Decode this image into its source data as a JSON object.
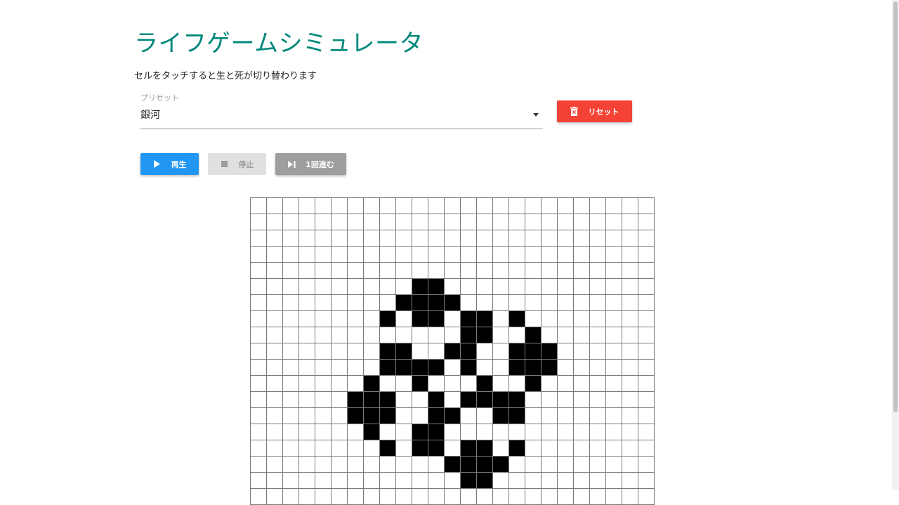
{
  "page": {
    "title": "ライフゲームシミュレータ",
    "description": "セルをタッチすると生と死が切り替わります"
  },
  "preset": {
    "label": "プリセット",
    "value": "銀河"
  },
  "buttons": {
    "reset": {
      "label": "リセット",
      "icon": "trash-icon"
    },
    "play": {
      "label": "再生",
      "icon": "play-icon"
    },
    "stop": {
      "label": "停止",
      "icon": "stop-icon"
    },
    "step": {
      "label": "1回進む",
      "icon": "skip-next-icon"
    }
  },
  "colors": {
    "accent": "#00897b",
    "reset": "#f44336",
    "play": "#2196f3",
    "stop_disabled": "#e0e0e0",
    "step": "#9e9e9e"
  },
  "grid": {
    "columns": 25,
    "visible_rows": 19,
    "alive": [
      [
        5,
        10
      ],
      [
        5,
        11
      ],
      [
        6,
        9
      ],
      [
        6,
        10
      ],
      [
        6,
        11
      ],
      [
        6,
        12
      ],
      [
        7,
        8
      ],
      [
        7,
        10
      ],
      [
        7,
        11
      ],
      [
        7,
        13
      ],
      [
        7,
        14
      ],
      [
        7,
        16
      ],
      [
        8,
        13
      ],
      [
        8,
        14
      ],
      [
        8,
        17
      ],
      [
        9,
        8
      ],
      [
        9,
        9
      ],
      [
        9,
        12
      ],
      [
        9,
        13
      ],
      [
        9,
        16
      ],
      [
        9,
        17
      ],
      [
        9,
        18
      ],
      [
        10,
        8
      ],
      [
        10,
        9
      ],
      [
        10,
        10
      ],
      [
        10,
        11
      ],
      [
        10,
        13
      ],
      [
        10,
        16
      ],
      [
        10,
        17
      ],
      [
        10,
        18
      ],
      [
        11,
        7
      ],
      [
        11,
        10
      ],
      [
        11,
        14
      ],
      [
        11,
        17
      ],
      [
        12,
        6
      ],
      [
        12,
        7
      ],
      [
        12,
        8
      ],
      [
        12,
        11
      ],
      [
        12,
        13
      ],
      [
        12,
        14
      ],
      [
        12,
        15
      ],
      [
        12,
        16
      ],
      [
        13,
        6
      ],
      [
        13,
        7
      ],
      [
        13,
        8
      ],
      [
        13,
        11
      ],
      [
        13,
        12
      ],
      [
        13,
        15
      ],
      [
        13,
        16
      ],
      [
        14,
        7
      ],
      [
        14,
        10
      ],
      [
        14,
        11
      ],
      [
        15,
        8
      ],
      [
        15,
        10
      ],
      [
        15,
        11
      ],
      [
        15,
        13
      ],
      [
        15,
        14
      ],
      [
        15,
        16
      ],
      [
        16,
        12
      ],
      [
        16,
        13
      ],
      [
        16,
        14
      ],
      [
        16,
        15
      ],
      [
        17,
        13
      ],
      [
        17,
        14
      ]
    ]
  }
}
